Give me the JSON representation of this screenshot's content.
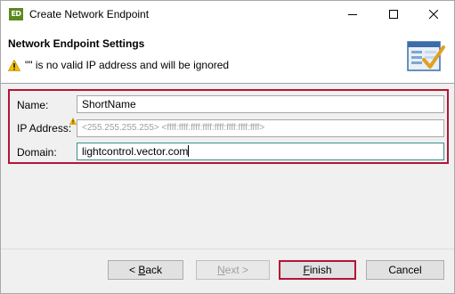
{
  "window": {
    "title": "Create Network Endpoint",
    "icon_text": "ED",
    "controls": [
      "minimize-icon",
      "maximize-icon",
      "close-icon"
    ]
  },
  "header": {
    "title": "Network Endpoint Settings",
    "message": "\"\" is no valid IP address and will be ignored",
    "message_icon": "warning-icon",
    "banner_icon": "wizard-banner-icon"
  },
  "form": {
    "name_label": "Name:",
    "name_value": "ShortName",
    "ip_label": "IP Address:",
    "ip_value": "",
    "ip_placeholder": "<255.255.255.255> <ffff:ffff:ffff:ffff:ffff:ffff:ffff:ffff>",
    "domain_label": "Domain:",
    "domain_value": "lightcontrol.vector.com"
  },
  "buttons": {
    "back_mnemonic": "B",
    "back_rest": "ack",
    "back_prefix": "< ",
    "next_mnemonic": "N",
    "next_rest": "ext >",
    "finish_mnemonic": "F",
    "finish_rest": "inish",
    "cancel_label": "Cancel"
  },
  "colors": {
    "highlight": "#b31535",
    "focus_border": "#3a8e8e",
    "warning": "#f5c000"
  }
}
